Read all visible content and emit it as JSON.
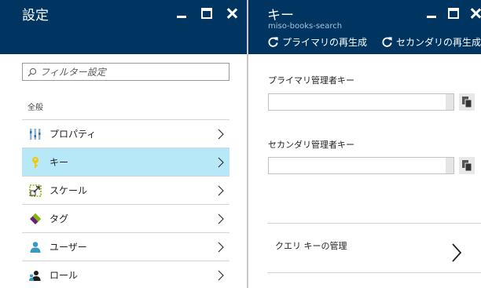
{
  "settings": {
    "title": "設定",
    "filter_placeholder": "フィルター設定",
    "group_label": "全般",
    "items": [
      {
        "label": "プロパティ",
        "icon": "properties-icon",
        "selected": false
      },
      {
        "label": "キー",
        "icon": "key-icon",
        "selected": true
      },
      {
        "label": "スケール",
        "icon": "scale-icon",
        "selected": false
      },
      {
        "label": "タグ",
        "icon": "tag-icon",
        "selected": false
      },
      {
        "label": "ユーザー",
        "icon": "user-icon",
        "selected": false
      },
      {
        "label": "ロール",
        "icon": "role-icon",
        "selected": false
      }
    ]
  },
  "keys": {
    "title": "キー",
    "subtitle": "miso-books-search",
    "commands": {
      "regen_primary": "プライマリの再生成",
      "regen_secondary": "セカンダリの再生成"
    },
    "primary_label": "プライマリ管理者キー",
    "primary_value": "",
    "secondary_label": "セカンダリ管理者キー",
    "secondary_value": "",
    "query_keys_label": "クエリ キーの管理"
  },
  "colors": {
    "header_bg": "#003561",
    "selected_bg": "#b6e8f8",
    "subtitle": "#a9c2db"
  }
}
